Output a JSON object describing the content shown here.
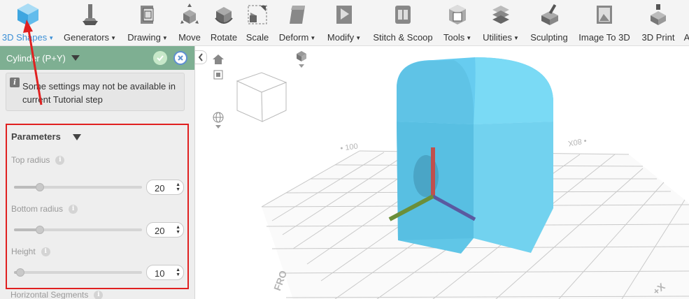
{
  "toolbar": {
    "items": [
      {
        "label": "3D Shapes",
        "icon": "cube-icon",
        "dropdown": true,
        "active": true
      },
      {
        "label": "Generators",
        "icon": "generator-icon",
        "dropdown": true
      },
      {
        "label": "Drawing",
        "icon": "drawing-icon",
        "dropdown": true
      },
      {
        "label": "Move",
        "icon": "move-icon",
        "dropdown": false
      },
      {
        "label": "Rotate",
        "icon": "rotate-icon",
        "dropdown": false
      },
      {
        "label": "Scale",
        "icon": "scale-icon",
        "dropdown": false
      },
      {
        "label": "Deform",
        "icon": "deform-icon",
        "dropdown": true
      },
      {
        "label": "Modify",
        "icon": "modify-icon",
        "dropdown": true
      },
      {
        "label": "Stitch & Scoop",
        "icon": "stitch-scoop-icon",
        "dropdown": false
      },
      {
        "label": "Tools",
        "icon": "tools-icon",
        "dropdown": true
      },
      {
        "label": "Utilities",
        "icon": "utilities-icon",
        "dropdown": true
      },
      {
        "label": "Sculpting",
        "icon": "sculpting-icon",
        "dropdown": false
      },
      {
        "label": "Image To 3D",
        "icon": "image-to-3d-icon",
        "dropdown": false
      },
      {
        "label": "3D Print",
        "icon": "3d-print-icon",
        "dropdown": false
      },
      {
        "label": "A",
        "icon": "",
        "dropdown": false
      }
    ]
  },
  "panel": {
    "title": "Cylinder (P+Y)",
    "notice": "Some settings may not be available in current Tutorial step",
    "section_title": "Parameters",
    "fields": [
      {
        "label": "Top radius",
        "value": "20",
        "level": 0.2
      },
      {
        "label": "Bottom radius",
        "value": "20",
        "level": 0.2
      },
      {
        "label": "Height",
        "value": "10",
        "level": 0.05
      }
    ],
    "next_field": "Horizontal Segments"
  },
  "colors": {
    "panel_header": "#7eaf92",
    "highlight_border": "#e02020",
    "active_accent": "#3b8fd6",
    "shape_fill": "#5bc6e6"
  }
}
